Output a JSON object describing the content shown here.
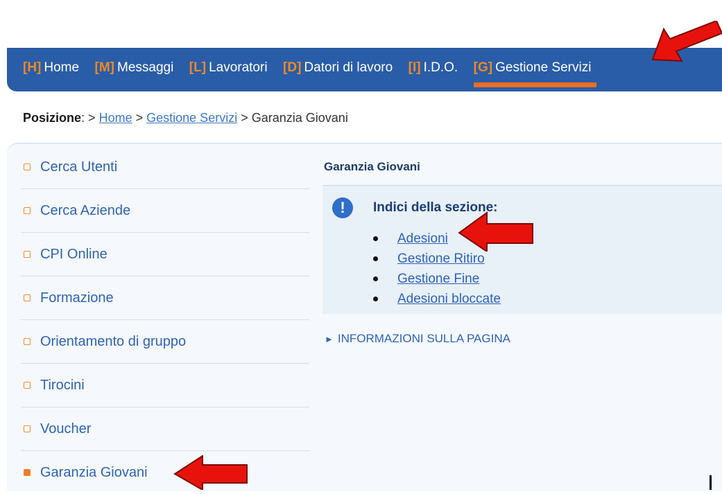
{
  "nav": {
    "items": [
      {
        "key": "[H]",
        "label": "Home"
      },
      {
        "key": "[M]",
        "label": "Messaggi"
      },
      {
        "key": "[L]",
        "label": "Lavoratori"
      },
      {
        "key": "[D]",
        "label": "Datori di lavoro"
      },
      {
        "key": "[I]",
        "label": "I.D.O."
      },
      {
        "key": "[G]",
        "label": "Gestione Servizi"
      }
    ],
    "active_index": 5
  },
  "breadcrumb": {
    "label": "Posizione",
    "separator_colon": ":",
    "sep": ">",
    "home": "Home",
    "section": "Gestione Servizi",
    "current": "Garanzia Giovani"
  },
  "menu": {
    "items": [
      "Cerca Utenti",
      "Cerca Aziende",
      "CPI Online",
      "Formazione",
      "Orientamento di gruppo",
      "Tirocini",
      "Voucher",
      "Garanzia Giovani"
    ],
    "active_index": 7
  },
  "content": {
    "section_title": "Garanzia Giovani",
    "index_title": "Indici della sezione:",
    "info_icon_glyph": "!",
    "links": [
      "Adesioni",
      "Gestione Ritiro",
      "Gestione Fine",
      "Adesioni bloccate"
    ],
    "info_toggle_glyph": "►",
    "info_toggle": "INFORMAZIONI SULLA PAGINA"
  },
  "colors": {
    "nav_bg": "#2a5da8",
    "accent_orange": "#f26d21",
    "link_blue": "#2d63b5",
    "arrow_red": "#e8120c"
  },
  "icons": [
    "info-icon",
    "menu-bullet-icon",
    "expand-triangle-icon",
    "annotation-arrow-icon"
  ]
}
